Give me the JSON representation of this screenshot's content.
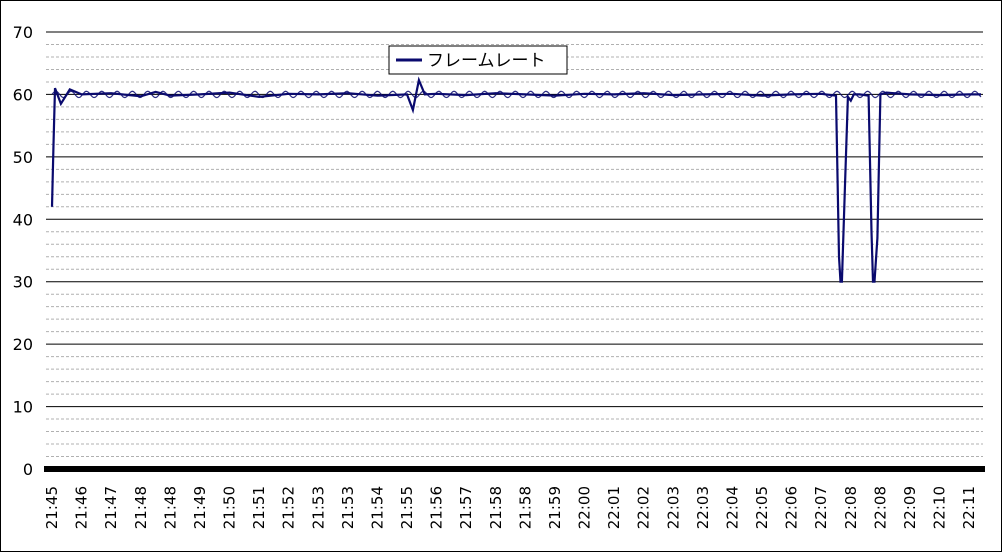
{
  "chart_data": {
    "type": "line",
    "title": "",
    "xlabel": "",
    "ylabel": "",
    "ylim": [
      0,
      70
    ],
    "y_major_ticks": [
      0,
      10,
      20,
      30,
      40,
      50,
      60,
      70
    ],
    "y_minor_step": 2,
    "grid": {
      "major": "solid",
      "minor": "dashed"
    },
    "legend_placement": "top-center",
    "x_tick_labels": [
      "21:45",
      "21:46",
      "21:47",
      "21:48",
      "21:48",
      "21:49",
      "21:50",
      "21:51",
      "21:52",
      "21:53",
      "21:53",
      "21:54",
      "21:55",
      "21:56",
      "21:57",
      "21:58",
      "21:58",
      "21:59",
      "22:00",
      "22:01",
      "22:02",
      "22:03",
      "22:03",
      "22:04",
      "22:05",
      "22:06",
      "22:07",
      "22:08",
      "22:08",
      "22:09",
      "22:10",
      "22:11"
    ],
    "series": [
      {
        "name": "フレームレート",
        "color": "#0a0a6e",
        "x": [
          0,
          0.05,
          0.1,
          0.3,
          0.6,
          1,
          2,
          3,
          3.5,
          4,
          5,
          6,
          7,
          8,
          9,
          10,
          11,
          12,
          12.2,
          12.4,
          12.6,
          13,
          14,
          15,
          16,
          17,
          18,
          19,
          20,
          21,
          22,
          23,
          24,
          25,
          26,
          26.5,
          26.6,
          26.65,
          26.7,
          26.8,
          26.9,
          27.0,
          27.1,
          27.3,
          27.6,
          27.7,
          27.75,
          27.8,
          27.9,
          28.0,
          28.2,
          29,
          30,
          31,
          31.4
        ],
        "values": [
          42,
          52,
          61,
          58.5,
          60.8,
          60,
          60.2,
          59.7,
          60.4,
          59.8,
          60,
          60.3,
          59.6,
          60.1,
          60,
          60.2,
          59.8,
          60,
          57.5,
          62.3,
          60,
          60.1,
          59.9,
          60.2,
          60,
          59.8,
          60.1,
          60,
          60.2,
          59.9,
          60,
          60.1,
          59.8,
          60,
          60.1,
          59.8,
          34,
          30,
          30,
          45,
          59.6,
          59,
          60,
          60,
          59.8,
          38,
          30,
          30,
          37,
          60,
          60.3,
          60,
          59.9,
          60,
          60
        ]
      }
    ]
  }
}
